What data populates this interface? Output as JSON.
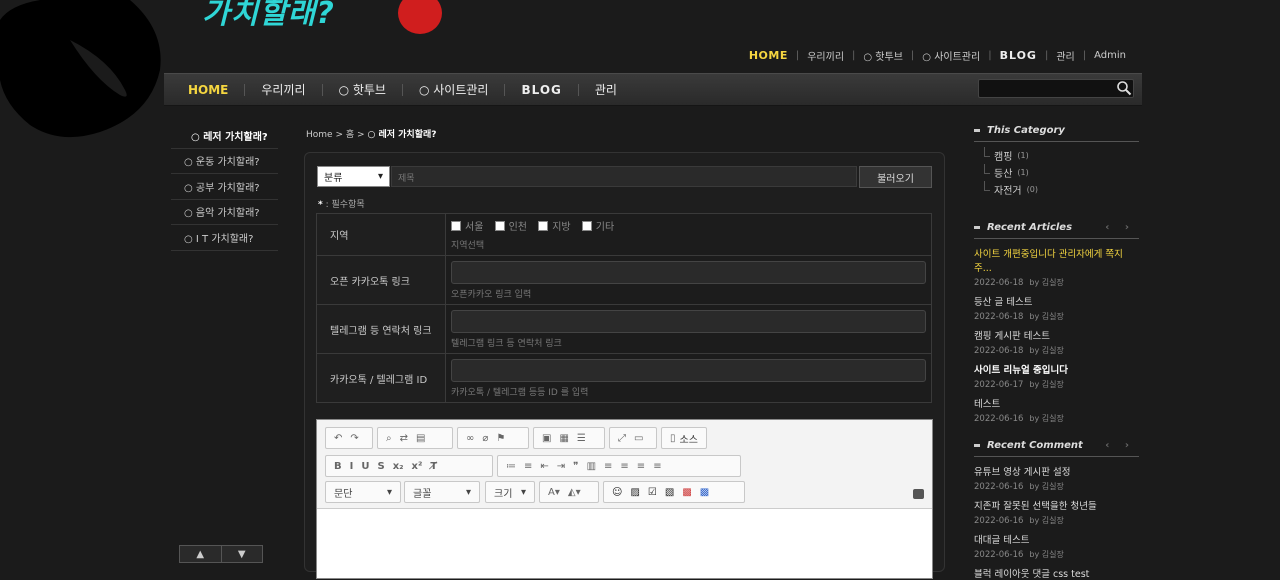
{
  "site": {
    "logo_text": "가치할래?"
  },
  "top_nav": [
    "HOME",
    "우리끼리",
    "○ 핫투브",
    "○ 사이트관리",
    "BLOG",
    "관리",
    "Admin"
  ],
  "main_nav": [
    "HOME",
    "우리끼리",
    "○ 핫투브",
    "○ 사이트관리",
    "BLOG",
    "관리"
  ],
  "left_menu": [
    "○ 레저 가치할래?",
    "○ 운동 가치할래?",
    "○ 공부 가치할래?",
    "○ 음악 가치할래?",
    "○ I T 가치할래?"
  ],
  "updown": {
    "up": "▲",
    "down": "▼"
  },
  "breadcrumb": {
    "home": "Home",
    "sep": ">",
    "mid": "홈",
    "current": "○ 레저 가치할래?"
  },
  "form": {
    "category_select": "분류",
    "title_placeholder": "제목",
    "load_button": "불러오기",
    "required_mark": "*",
    "required_note": ": 필수항목",
    "rows": [
      {
        "label": "지역",
        "hint": "지역선택",
        "options": [
          "서울",
          "인천",
          "지방",
          "기타"
        ]
      },
      {
        "label": "오픈 카카오톡 링크",
        "hint": "오픈카카오 링크 입력"
      },
      {
        "label": "텔레그램 등 연락처 링크",
        "hint": "텔레그램 링크 등 연락처 링크"
      },
      {
        "label": "카카오톡 / 텔레그램 ID",
        "hint": "카카오톡 / 텔레그램 등등 ID 를 입력"
      }
    ]
  },
  "editor": {
    "source_label": "소스",
    "paragraph": "문단",
    "font": "글꼴",
    "size": "크기"
  },
  "sidebar": {
    "this_category": {
      "title": "This Category",
      "items": [
        {
          "name": "캠핑",
          "count": "(1)"
        },
        {
          "name": "등산",
          "count": "(1)"
        },
        {
          "name": "자전거",
          "count": "(0)"
        }
      ]
    },
    "recent_articles": {
      "title": "Recent Articles",
      "arrows": "‹ ›",
      "items": [
        {
          "title": "사이트 개편중입니다 관리자에게 쪽지주...",
          "date": "2022-06-18",
          "by": "by 김실장"
        },
        {
          "title": "등산 글 테스트",
          "date": "2022-06-18",
          "by": "by 김실장"
        },
        {
          "title": "캠핑 게시판 테스트",
          "date": "2022-06-18",
          "by": "by 김실장"
        },
        {
          "title": "사이트 리뉴얼 중입니다",
          "date": "2022-06-17",
          "by": "by 김실장"
        },
        {
          "title": "테스트",
          "date": "2022-06-16",
          "by": "by 김실장"
        }
      ]
    },
    "recent_comment": {
      "title": "Recent Comment",
      "arrows": "‹ ›",
      "items": [
        {
          "title": "유튜브 영상 게시판 설정",
          "date": "2022-06-16",
          "by": "by 김실장"
        },
        {
          "title": "지존파 잘못된 선택을한 청년들",
          "date": "2022-06-16",
          "by": "by 김실장"
        },
        {
          "title": "대대글 테스트",
          "date": "2022-06-16",
          "by": "by 김실장"
        },
        {
          "title": "블럭 레이아웃 댓글 css test",
          "date": "",
          "by": ""
        }
      ]
    }
  },
  "colors": {
    "accent": "#f5d640",
    "logo_cyan": "#2fd6d6",
    "logo_red": "#d01e1e",
    "bg": "#1b1b1b"
  }
}
